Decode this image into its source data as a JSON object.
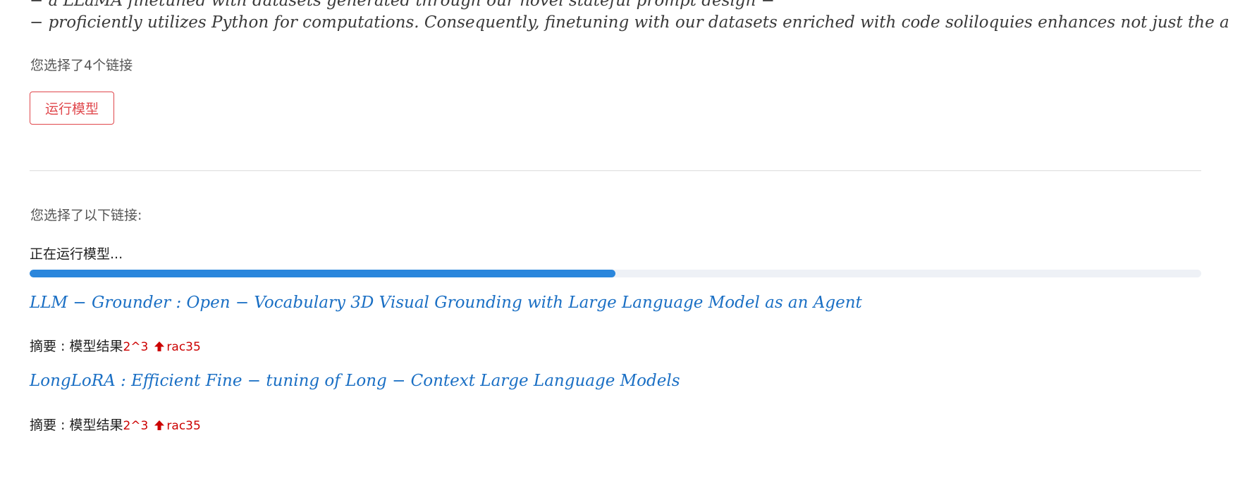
{
  "top_lines": [
    "− a LLaMA finetuned with datasets generated through our novel stateful prompt design −",
    "− proficiently utilizes Python for computations. Consequently,  finetuning with our datasets enriched with code soliloquies enhances not just the a"
  ],
  "selection_count_text": "您选择了4个链接",
  "run_button_label": "运行模型",
  "selected_links_heading": "您选择了以下链接:",
  "running_status": "正在运行模型...",
  "progress_fraction": 0.5,
  "results": [
    {
      "title": "LLM − Grounder :  Open − Vocabulary 3D Visual Grounding with Large Language Model as an Agent",
      "summary_label": "摘要 :  模型结果",
      "summary_prefix": "2^3",
      "summary_suffix": "rac35"
    },
    {
      "title": " LongLoRA :  Efficient Fine − tuning of Long − Context Large Language Models",
      "summary_label": "摘要 :  模型结果",
      "summary_prefix": "2^3",
      "summary_suffix": "rac35"
    }
  ],
  "colors": {
    "accent_red": "#e0474c",
    "link_blue": "#1a6fc4",
    "progress_blue": "#2a86dc",
    "error_red": "#cc0000"
  }
}
